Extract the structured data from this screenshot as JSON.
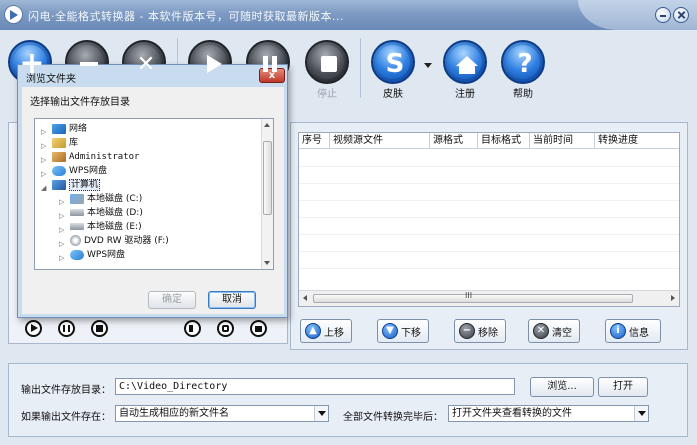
{
  "window": {
    "title": "闪电·全能格式转换器 - 本软件版本号，可随时获取最新版本..."
  },
  "toolbar": {
    "buttons": [
      {
        "id": "add",
        "label": "",
        "icon": "add-icon"
      },
      {
        "id": "remove",
        "label": "",
        "icon": "remove-icon"
      },
      {
        "id": "clear",
        "label": "",
        "icon": "close-icon"
      },
      {
        "id": "play",
        "label": "",
        "icon": "play-icon"
      },
      {
        "id": "pause",
        "label": "",
        "icon": "pause-icon"
      },
      {
        "id": "stop",
        "label": "停止",
        "icon": "stop-icon",
        "disabled": true
      },
      {
        "id": "skin",
        "label": "皮肤",
        "icon": "skin-s-icon"
      },
      {
        "id": "register",
        "label": "注册",
        "icon": "home-icon"
      },
      {
        "id": "help",
        "label": "帮助",
        "icon": "help-icon"
      }
    ]
  },
  "table": {
    "columns": [
      "序号",
      "视频源文件",
      "源格式",
      "目标格式",
      "当前时间",
      "转换进度"
    ],
    "rows": [],
    "scroll_grip": "III"
  },
  "list_actions": {
    "move_up": "上移",
    "move_down": "下移",
    "remove": "移除",
    "clear": "清空",
    "info": "信息"
  },
  "settings": {
    "output_dir_label": "输出文件存放目录：",
    "output_dir_value": "C:\\Video_Directory",
    "browse_label": "浏览...",
    "open_label": "打开",
    "exists_label": "如果输出文件存在：",
    "exists_value": "自动生成相应的新文件名",
    "after_label": "全部文件转换完毕后：",
    "after_value": "打开文件夹查看转换的文件"
  },
  "dialog": {
    "title": "浏览文件夹",
    "close_glyph": "x",
    "prompt": "选择输出文件存放目录",
    "tree": [
      {
        "label": "网络",
        "icon": "network-icon",
        "indent": 0,
        "expander": "▷"
      },
      {
        "label": "库",
        "icon": "library-icon",
        "indent": 0,
        "expander": "▷"
      },
      {
        "label": "Administrator",
        "icon": "user-folder-icon",
        "indent": 0,
        "expander": "▷"
      },
      {
        "label": "WPS网盘",
        "icon": "cloud-icon",
        "indent": 0,
        "expander": "▷"
      },
      {
        "label": "计算机",
        "icon": "computer-icon",
        "indent": 0,
        "expander": "◢",
        "selected": true
      },
      {
        "label": "本地磁盘 (C:)",
        "icon": "system-disk-icon",
        "indent": 1,
        "expander": "▷"
      },
      {
        "label": "本地磁盘 (D:)",
        "icon": "disk-icon",
        "indent": 1,
        "expander": "▷"
      },
      {
        "label": "本地磁盘 (E:)",
        "icon": "disk-icon",
        "indent": 1,
        "expander": "▷"
      },
      {
        "label": "DVD RW 驱动器 (F:)",
        "icon": "dvd-icon",
        "indent": 1,
        "expander": "▷"
      },
      {
        "label": "WPS网盘",
        "icon": "cloud-icon",
        "indent": 1,
        "expander": "▷"
      }
    ],
    "ok_label": "确定",
    "cancel_label": "取消"
  },
  "colors": {
    "background": "#dfe7f1",
    "title_bar": "#7d9ac2",
    "toolbar_blue": "#2f7fe0",
    "toolbar_dark": "#3a3f47"
  }
}
